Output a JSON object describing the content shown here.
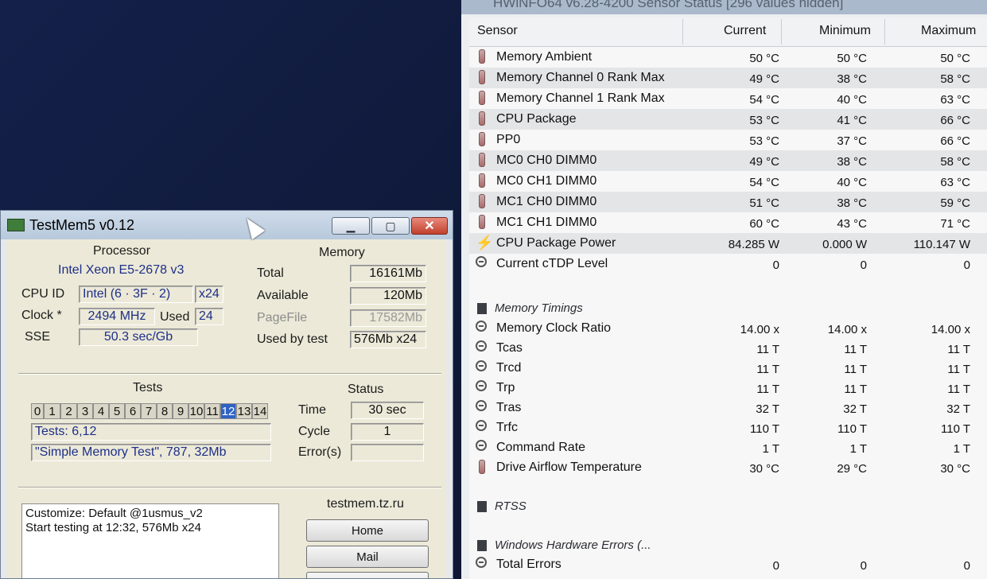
{
  "hwinfo": {
    "title": "HWiNFO64 v6.28-4200 Sensor Status [296 values hidden]",
    "columns": {
      "sensor": "Sensor",
      "current": "Current",
      "minimum": "Minimum",
      "maximum": "Maximum"
    },
    "rows": [
      {
        "icon": "thermometer-icon",
        "label": "Memory Ambient",
        "current": "50 °C",
        "min": "50 °C",
        "max": "50 °C"
      },
      {
        "icon": "thermometer-icon",
        "label": "Memory Channel 0 Rank Max",
        "current": "49 °C",
        "min": "38 °C",
        "max": "58 °C"
      },
      {
        "icon": "thermometer-icon",
        "label": "Memory Channel 1 Rank Max",
        "current": "54 °C",
        "min": "40 °C",
        "max": "63 °C"
      },
      {
        "icon": "thermometer-icon",
        "label": "CPU Package",
        "current": "53 °C",
        "min": "41 °C",
        "max": "66 °C"
      },
      {
        "icon": "thermometer-icon",
        "label": "PP0",
        "current": "53 °C",
        "min": "37 °C",
        "max": "66 °C"
      },
      {
        "icon": "thermometer-icon",
        "label": "MC0 CH0 DIMM0",
        "current": "49 °C",
        "min": "38 °C",
        "max": "58 °C"
      },
      {
        "icon": "thermometer-icon",
        "label": "MC0 CH1 DIMM0",
        "current": "54 °C",
        "min": "40 °C",
        "max": "63 °C"
      },
      {
        "icon": "thermometer-icon",
        "label": "MC1 CH0 DIMM0",
        "current": "51 °C",
        "min": "38 °C",
        "max": "59 °C"
      },
      {
        "icon": "thermometer-icon",
        "label": "MC1 CH1 DIMM0",
        "current": "60 °C",
        "min": "43 °C",
        "max": "71 °C"
      },
      {
        "icon": "power-bolt-icon",
        "label": "CPU Package Power",
        "current": "84.285 W",
        "min": "0.000 W",
        "max": "110.147 W"
      },
      {
        "icon": "clock-icon",
        "label": "Current cTDP Level",
        "current": "0",
        "min": "0",
        "max": "0"
      }
    ],
    "groups": {
      "memory_timings": "Memory Timings",
      "rtss": "RTSS",
      "whea": "Windows Hardware Errors (..."
    },
    "timing_rows": [
      {
        "icon": "clock-icon",
        "label": "Memory Clock Ratio",
        "current": "14.00 x",
        "min": "14.00 x",
        "max": "14.00 x"
      },
      {
        "icon": "clock-icon",
        "label": "Tcas",
        "current": "11 T",
        "min": "11 T",
        "max": "11 T"
      },
      {
        "icon": "clock-icon",
        "label": "Trcd",
        "current": "11 T",
        "min": "11 T",
        "max": "11 T"
      },
      {
        "icon": "clock-icon",
        "label": "Trp",
        "current": "11 T",
        "min": "11 T",
        "max": "11 T"
      },
      {
        "icon": "clock-icon",
        "label": "Tras",
        "current": "32 T",
        "min": "32 T",
        "max": "32 T"
      },
      {
        "icon": "clock-icon",
        "label": "Trfc",
        "current": "110 T",
        "min": "110 T",
        "max": "110 T"
      },
      {
        "icon": "clock-icon",
        "label": "Command Rate",
        "current": "1 T",
        "min": "1 T",
        "max": "1 T"
      },
      {
        "icon": "thermometer-icon",
        "label": "Drive Airflow Temperature",
        "current": "30 °C",
        "min": "29 °C",
        "max": "30 °C"
      }
    ],
    "total_errors": {
      "icon": "clock-icon",
      "label": "Total Errors",
      "current": "0",
      "min": "0",
      "max": "0"
    }
  },
  "testmem": {
    "title": "TestMem5 v0.12",
    "processor": {
      "heading": "Processor",
      "name": "Intel Xeon  E5-2678 v3",
      "cpu_id_label": "CPU ID",
      "cpu_id_value": "Intel  (6 · 3F · 2)",
      "threads": "x24",
      "clock_label": "Clock *",
      "clock_value": "2494 MHz",
      "used_label": "Used",
      "used_value": "24",
      "sse_label": "SSE",
      "sse_value": "50.3 sec/Gb"
    },
    "memory": {
      "heading": "Memory",
      "total_label": "Total",
      "total_value": "16161Mb",
      "available_label": "Available",
      "available_value": "120Mb",
      "pagefile_label": "PageFile",
      "pagefile_value": "17582Mb",
      "usedbytest_label": "Used by test",
      "usedbytest_value": "576Mb x24"
    },
    "tests": {
      "heading": "Tests",
      "numbers": [
        "0",
        "1",
        "2",
        "3",
        "4",
        "5",
        "6",
        "7",
        "8",
        "9",
        "10",
        "11",
        "12",
        "13",
        "14"
      ],
      "selected": "12",
      "tests_line": "Tests: 6,12",
      "current_test": "\"Simple Memory Test\", 787, 32Mb"
    },
    "status": {
      "heading": "Status",
      "time_label": "Time",
      "time_value": "30 sec",
      "cycle_label": "Cycle",
      "cycle_value": "1",
      "errors_label": "Error(s)",
      "errors_value": ""
    },
    "log": {
      "line1": "Customize: Default @1usmus_v2",
      "line2": "Start testing at 12:32, 576Mb x24"
    },
    "links": {
      "site": "testmem.tz.ru",
      "home": "Home",
      "mail": "Mail"
    }
  }
}
